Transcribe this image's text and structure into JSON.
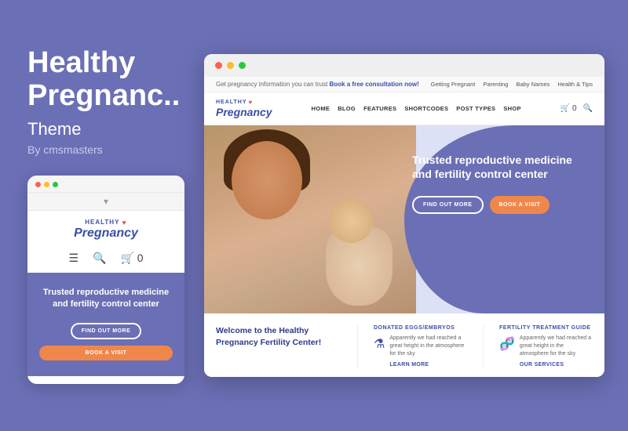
{
  "left": {
    "title_line1": "Healthy",
    "title_line2": "Pregnanc..",
    "subtitle": "Theme",
    "author": "By cmsmasters"
  },
  "mobile": {
    "logo_healthy": "HEALTHY",
    "logo_pregnancy": "Pregnancy",
    "hero_text": "Trusted reproductive medicine and fertility control center",
    "btn_find_out": "FIND OUT MORE",
    "btn_book": "BOOK A VISIT",
    "cart_label": "🛒 0"
  },
  "browser": {
    "announcement": {
      "text": "Get pregnancy information you can trust",
      "link": "Book a free consultation now!",
      "nav_items": [
        "Getting Pregnant",
        "Parenting",
        "Baby Names",
        "Health & Tips"
      ]
    },
    "nav": {
      "logo_healthy": "HEALTHY ♥",
      "logo_pregnancy": "Pregnancy",
      "links": [
        "HOME",
        "BLOG",
        "FEATURES",
        "SHORTCODES",
        "POST TYPES",
        "SHOP"
      ],
      "cart": "🛒 0"
    },
    "hero": {
      "title": "Trusted reproductive medicine and fertility control center",
      "btn_find_out": "FIND OUT MORE",
      "btn_book": "BOOK A VISIT"
    },
    "info": {
      "main_title": "Welcome to the Healthy Pregnancy Fertility Center!",
      "col1_label": "DONATED EGGS/EMBRYOS",
      "col1_text": "Apparently we had reached a great height in the atmosphere for the sky",
      "col1_link": "LEARN MORE",
      "col2_label": "FERTILITY TREATMENT GUIDE",
      "col2_text": "Apparently we had reached a great height in the atmosphere for the sky",
      "col2_link": "OUR SERVICES"
    }
  },
  "colors": {
    "accent_blue": "#3b4fa8",
    "accent_purple": "#6b6fb5",
    "accent_orange": "#f0874a",
    "white": "#ffffff"
  }
}
